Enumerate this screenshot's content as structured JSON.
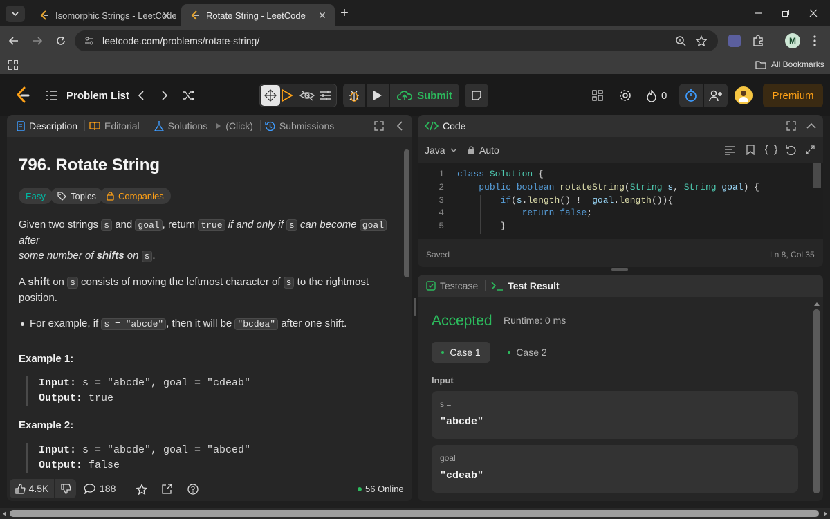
{
  "browser": {
    "tabs": [
      {
        "title": "Isomorphic Strings - LeetCode",
        "active": false
      },
      {
        "title": "Rotate String - LeetCode",
        "active": true
      }
    ],
    "url": "leetcode.com/problems/rotate-string/",
    "bookmarks_label": "All Bookmarks",
    "profile_initial": "M"
  },
  "header": {
    "problem_list": "Problem List",
    "submit": "Submit",
    "streak_count": "0",
    "premium": "Premium"
  },
  "description_panel": {
    "tabs": [
      "Description",
      "Editorial",
      "Solutions",
      "(Click)",
      "Submissions"
    ],
    "title": "796. Rotate String",
    "difficulty": "Easy",
    "topics": "Topics",
    "companies": "Companies",
    "para1": {
      "t1": "Given two strings ",
      "c1": "s",
      "t2": " and ",
      "c2": "goal",
      "t3": ", return ",
      "c3": "true",
      "t4": " if and only if ",
      "c4": "s",
      "t5": " can become ",
      "c5": "goal",
      "t6": " after",
      "t7": "some number of ",
      "t8": "shifts",
      "t9": " on ",
      "c6": "s",
      "t10": "."
    },
    "para2": {
      "t1": "A ",
      "b1": "shift",
      "t2": " on ",
      "c1": "s",
      "t3": " consists of moving the leftmost character of ",
      "c2": "s",
      "t4": " to the rightmost",
      "t5": "position."
    },
    "bullet": {
      "t1": "For example, if ",
      "c1": "s = \"abcde\"",
      "t2": ", then it will be ",
      "c2": "\"bcdea\"",
      "t3": " after one shift."
    },
    "examples": [
      {
        "heading": "Example 1:",
        "input_label": "Input:",
        "input": " s = \"abcde\", goal = \"cdeab\"",
        "output_label": "Output:",
        "output": " true"
      },
      {
        "heading": "Example 2:",
        "input_label": "Input:",
        "input": " s = \"abcde\", goal = \"abced\"",
        "output_label": "Output:",
        "output": " false"
      }
    ],
    "likes": "4.5K",
    "comments": "188",
    "online": "56 Online"
  },
  "code_panel": {
    "title": "Code",
    "language": "Java",
    "mode": "Auto",
    "lines": [
      "1",
      "2",
      "3",
      "4",
      "5"
    ],
    "status": "Saved",
    "cursor": "Ln 8, Col 35"
  },
  "result_panel": {
    "tabs": [
      "Testcase",
      "Test Result"
    ],
    "verdict": "Accepted",
    "runtime": "Runtime: 0 ms",
    "cases": [
      "Case 1",
      "Case 2"
    ],
    "input_heading": "Input",
    "inputs": [
      {
        "label": "s =",
        "value": "\"abcde\""
      },
      {
        "label": "goal =",
        "value": "\"cdeab\""
      }
    ]
  },
  "colors": {
    "accent_green": "#2cbb5d",
    "easy": "#00b8a3",
    "companies": "#ffa116",
    "premium_text": "#ffa116"
  }
}
